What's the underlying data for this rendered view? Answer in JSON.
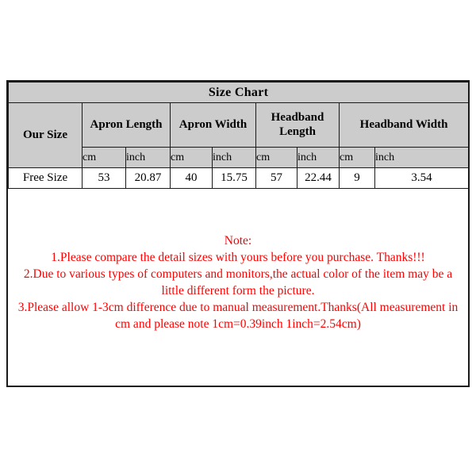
{
  "table": {
    "title": "Size Chart",
    "size_label": "Our Size",
    "groups": [
      {
        "label": "Apron Length"
      },
      {
        "label": "Apron Width"
      },
      {
        "label": "Headband Length"
      },
      {
        "label": "Headband Width"
      }
    ],
    "units": [
      "cm",
      "inch",
      "cm",
      "inch",
      "cm",
      "inch",
      "cm",
      "inch"
    ],
    "rows": [
      {
        "size": "Free Size",
        "values": [
          "53",
          "20.87",
          "40",
          "15.75",
          "57",
          "22.44",
          "9",
          "3.54"
        ]
      }
    ]
  },
  "note": {
    "heading": "Note:",
    "lines": [
      "1.Please compare the detail sizes with yours before you purchase. Thanks!!!",
      "2.Due to various types of computers and monitors,the actual color of the item may be a little different form the picture.",
      "3.Please allow 1-3cm difference due to manual measurement.Thanks(All measurement in cm and please note 1cm=0.39inch 1inch=2.54cm)"
    ]
  },
  "colors": {
    "header_bg": "#cccccc",
    "body_bg": "#ffffff",
    "border": "#1a1a1a",
    "note_text": "#fe0000",
    "table_text": "#000000"
  }
}
